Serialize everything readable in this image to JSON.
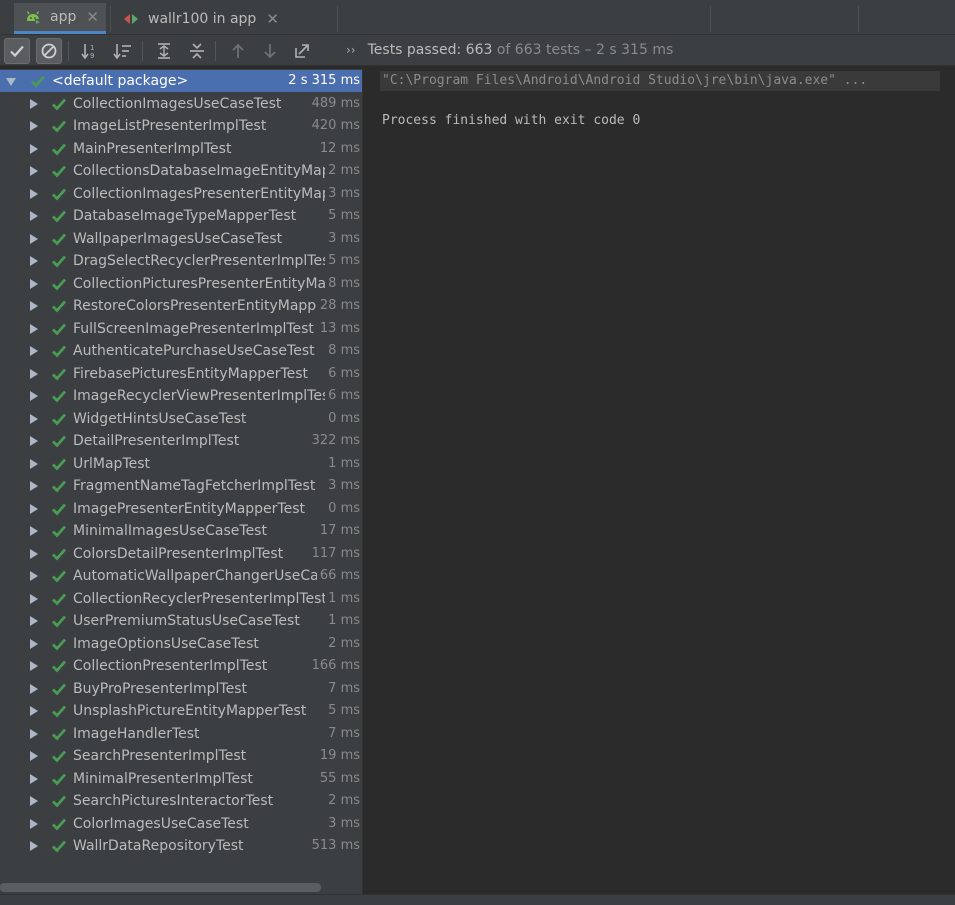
{
  "tabs": [
    {
      "label": "app",
      "icon": "android-icon"
    },
    {
      "label": "wallr100 in app",
      "icon": "run-config-icon"
    }
  ],
  "status": {
    "passed_label": "Tests passed:",
    "passed_count": "663",
    "of_total": "of 663 tests",
    "duration": "– 2 s 315 ms"
  },
  "root": {
    "name": "<default package>",
    "dur_value": "2 s 315",
    "dur_unit": "ms"
  },
  "tests": [
    {
      "name": "CollectionImagesUseCaseTest",
      "dur": "489"
    },
    {
      "name": "ImageListPresenterImplTest",
      "dur": "420"
    },
    {
      "name": "MainPresenterImplTest",
      "dur": "12"
    },
    {
      "name": "CollectionsDatabaseImageEntityMapperTest",
      "dur": "2"
    },
    {
      "name": "CollectionImagesPresenterEntityMapperTest",
      "dur": "3"
    },
    {
      "name": "DatabaseImageTypeMapperTest",
      "dur": "5"
    },
    {
      "name": "WallpaperImagesUseCaseTest",
      "dur": "3"
    },
    {
      "name": "DragSelectRecyclerPresenterImplTest",
      "dur": "5"
    },
    {
      "name": "CollectionPicturesPresenterEntityMapperTest",
      "dur": "8"
    },
    {
      "name": "RestoreColorsPresenterEntityMapperTest",
      "dur": "28"
    },
    {
      "name": "FullScreenImagePresenterImplTest",
      "dur": "13"
    },
    {
      "name": "AuthenticatePurchaseUseCaseTest",
      "dur": "8"
    },
    {
      "name": "FirebasePicturesEntityMapperTest",
      "dur": "6"
    },
    {
      "name": "ImageRecyclerViewPresenterImplTest",
      "dur": "6"
    },
    {
      "name": "WidgetHintsUseCaseTest",
      "dur": "0"
    },
    {
      "name": "DetailPresenterImplTest",
      "dur": "322"
    },
    {
      "name": "UrlMapTest",
      "dur": "1"
    },
    {
      "name": "FragmentNameTagFetcherImplTest",
      "dur": "3"
    },
    {
      "name": "ImagePresenterEntityMapperTest",
      "dur": "0"
    },
    {
      "name": "MinimalImagesUseCaseTest",
      "dur": "17"
    },
    {
      "name": "ColorsDetailPresenterImplTest",
      "dur": "117"
    },
    {
      "name": "AutomaticWallpaperChangerUseCaseTest",
      "dur": "66"
    },
    {
      "name": "CollectionRecyclerPresenterImplTest",
      "dur": "1"
    },
    {
      "name": "UserPremiumStatusUseCaseTest",
      "dur": "1"
    },
    {
      "name": "ImageOptionsUseCaseTest",
      "dur": "2"
    },
    {
      "name": "CollectionPresenterImplTest",
      "dur": "166"
    },
    {
      "name": "BuyProPresenterImplTest",
      "dur": "7"
    },
    {
      "name": "UnsplashPictureEntityMapperTest",
      "dur": "5"
    },
    {
      "name": "ImageHandlerTest",
      "dur": "7"
    },
    {
      "name": "SearchPresenterImplTest",
      "dur": "19"
    },
    {
      "name": "MinimalPresenterImplTest",
      "dur": "55"
    },
    {
      "name": "SearchPicturesInteractorTest",
      "dur": "2"
    },
    {
      "name": "ColorImagesUseCaseTest",
      "dur": "3"
    },
    {
      "name": "WallrDataRepositoryTest",
      "dur": "513"
    }
  ],
  "duration_unit": "ms",
  "console": {
    "command": "\"C:\\Program Files\\Android\\Android Studio\\jre\\bin\\java.exe\" ...",
    "exit_message": "Process finished with exit code 0"
  },
  "colors": {
    "pass_green": "#499c54",
    "selection": "#4b6eaf",
    "panel": "#3c3f41",
    "editor": "#2b2b2b"
  },
  "toolbar_icons": [
    "show-passed-icon",
    "show-ignored-icon",
    "sort-alphabetically-icon",
    "sort-by-duration-icon",
    "expand-all-icon",
    "collapse-all-icon",
    "previous-failed-icon",
    "next-failed-icon",
    "export-results-icon"
  ]
}
